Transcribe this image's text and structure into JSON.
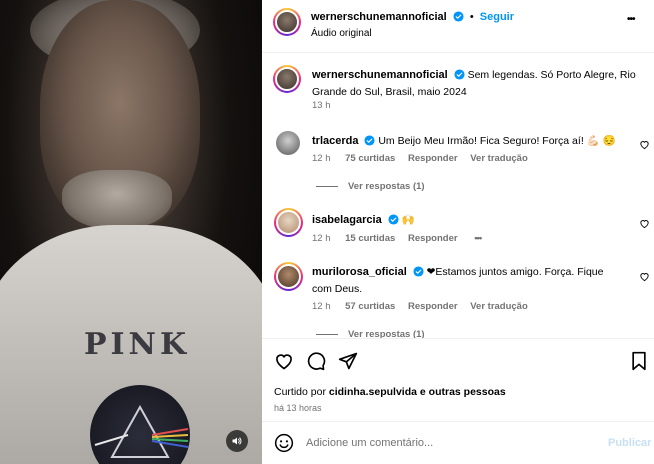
{
  "post": {
    "author": "wernerschunemannoficial",
    "follow_label": "Seguir",
    "separator": "•",
    "audio": "Áudio original",
    "more_label": "•••"
  },
  "caption": {
    "author": "wernerschunemannoficial",
    "text_line1": "Sem legendas. Só Porto Alegre, Rio",
    "text_line2": "Grande do Sul, Brasil, maio 2024",
    "time": "13 h"
  },
  "comments": [
    {
      "user": "trlacerda",
      "text": "Um Beijo Meu Irmão! Fica Seguro! Força aí! 💪🏻 😔",
      "time": "12 h",
      "likes": "75 curtidas",
      "reply": "Responder",
      "translate": "Ver tradução",
      "replies": "Ver respostas (1)"
    },
    {
      "user": "isabelagarcia",
      "text": "🙌",
      "time": "12 h",
      "likes": "15 curtidas",
      "reply": "Responder",
      "more": "•••"
    },
    {
      "user": "murilorosa_oficial",
      "text_line1": "❤Estamos juntos amigo. Força. Fique",
      "text_line2": "com Deus.",
      "time": "12 h",
      "likes": "57 curtidas",
      "reply": "Responder",
      "translate": "Ver tradução",
      "replies": "Ver respostas (1)"
    }
  ],
  "likes_summary": {
    "prefix": "Curtido por",
    "user": "cidinha.sepulvida",
    "suffix": "e outras pessoas",
    "time": "há 13 horas"
  },
  "composer": {
    "placeholder": "Adicione um comentário...",
    "publish_label": "Publicar"
  },
  "media": {
    "print_text": "PINK"
  },
  "colors": {
    "accent": "#0095f6",
    "verified": "#0095f6",
    "muted": "#737373",
    "publish_disabled": "#c7e0f4"
  }
}
